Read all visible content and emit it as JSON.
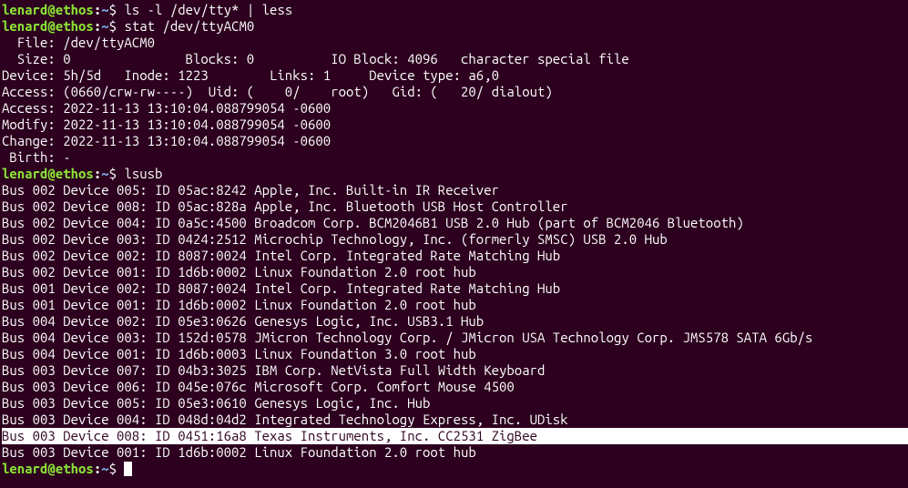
{
  "prompt": {
    "user": "lenard",
    "at": "@",
    "host": "ethos",
    "colon": ":",
    "path": "~",
    "dollar": "$"
  },
  "commands": {
    "c1": "ls -l /dev/tty* | less",
    "c2": "stat /dev/ttyACM0",
    "c3": "lsusb",
    "c4": ""
  },
  "stat": {
    "l1": "  File: /dev/ttyACM0",
    "l2": "  Size: 0               Blocks: 0          IO Block: 4096   character special file",
    "l3": "Device: 5h/5d   Inode: 1223        Links: 1     Device type: a6,0",
    "l4": "Access: (0660/crw-rw----)  Uid: (    0/    root)   Gid: (   20/ dialout)",
    "l5": "Access: 2022-11-13 13:10:04.088799054 -0600",
    "l6": "Modify: 2022-11-13 13:10:04.088799054 -0600",
    "l7": "Change: 2022-11-13 13:10:04.088799054 -0600",
    "l8": " Birth: -"
  },
  "lsusb": {
    "l01": "Bus 002 Device 005: ID 05ac:8242 Apple, Inc. Built-in IR Receiver",
    "l02": "Bus 002 Device 008: ID 05ac:828a Apple, Inc. Bluetooth USB Host Controller",
    "l03": "Bus 002 Device 004: ID 0a5c:4500 Broadcom Corp. BCM2046B1 USB 2.0 Hub (part of BCM2046 Bluetooth)",
    "l04": "Bus 002 Device 003: ID 0424:2512 Microchip Technology, Inc. (formerly SMSC) USB 2.0 Hub",
    "l05": "Bus 002 Device 002: ID 8087:0024 Intel Corp. Integrated Rate Matching Hub",
    "l06": "Bus 002 Device 001: ID 1d6b:0002 Linux Foundation 2.0 root hub",
    "l07": "Bus 001 Device 002: ID 8087:0024 Intel Corp. Integrated Rate Matching Hub",
    "l08": "Bus 001 Device 001: ID 1d6b:0002 Linux Foundation 2.0 root hub",
    "l09": "Bus 004 Device 002: ID 05e3:0626 Genesys Logic, Inc. USB3.1 Hub",
    "l10": "Bus 004 Device 003: ID 152d:0578 JMicron Technology Corp. / JMicron USA Technology Corp. JMS578 SATA 6Gb/s",
    "l11": "Bus 004 Device 001: ID 1d6b:0003 Linux Foundation 3.0 root hub",
    "l12": "Bus 003 Device 007: ID 04b3:3025 IBM Corp. NetVista Full Width Keyboard",
    "l13": "Bus 003 Device 006: ID 045e:076c Microsoft Corp. Comfort Mouse 4500",
    "l14": "Bus 003 Device 005: ID 05e3:0610 Genesys Logic, Inc. Hub",
    "l15": "Bus 003 Device 004: ID 048d:04d2 Integrated Technology Express, Inc. UDisk",
    "l16": "Bus 003 Device 008: ID 0451:16a8 Texas Instruments, Inc. CC2531 ZigBee",
    "l17": "Bus 003 Device 001: ID 1d6b:0002 Linux Foundation 2.0 root hub"
  }
}
